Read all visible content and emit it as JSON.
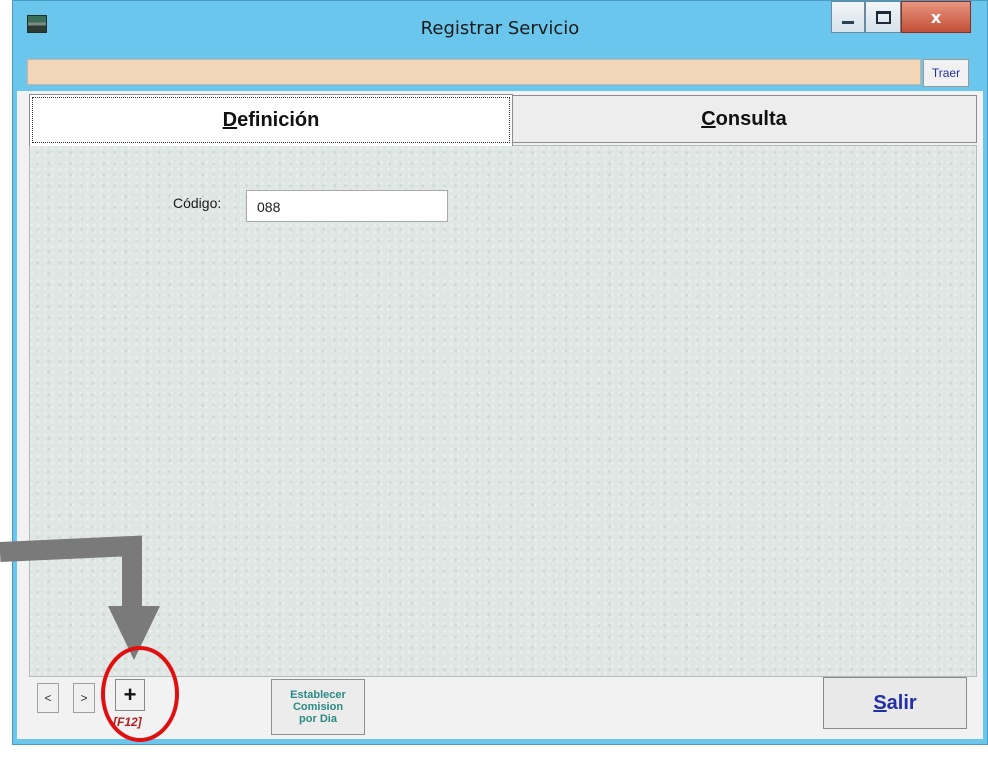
{
  "window": {
    "title": "Registrar Servicio",
    "close_glyph": "x"
  },
  "toolbar": {
    "traer_label": "Traer"
  },
  "tabs": [
    {
      "prefix": "",
      "mnemonic": "D",
      "rest": "efinición",
      "active": true
    },
    {
      "prefix": "",
      "mnemonic": "C",
      "rest": "onsulta",
      "active": false
    }
  ],
  "form": {
    "codigo_label": "Código:",
    "codigo_value": "088"
  },
  "bottom": {
    "prev_label": "<",
    "next_label": ">",
    "add_label": "+",
    "add_shortcut": "[F12]",
    "comision_line1": "Establecer",
    "comision_line2": "Comision",
    "comision_line3": "por Dia",
    "salir_mnemonic": "S",
    "salir_rest": "alir"
  },
  "colors": {
    "titlebar": "#6ac6ec",
    "infobar": "#f3d6b7",
    "annotation_arrow": "#7a7a7a",
    "annotation_circle": "#e01010"
  }
}
